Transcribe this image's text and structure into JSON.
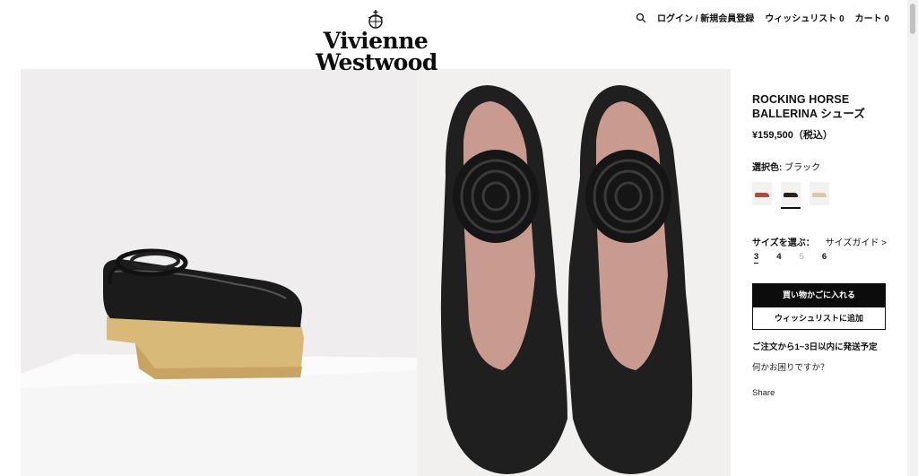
{
  "brand": {
    "line1": "Vivienne",
    "line2": "Westwood"
  },
  "nav": {
    "login": "ログイン / 新規会員登録",
    "wishlist": "ウィッシュリスト 0",
    "cart": "カート 0"
  },
  "product": {
    "title": "ROCKING HORSE BALLERINA シューズ",
    "price": "¥159,500（税込）",
    "color_label": "選択色:",
    "color_value": "ブラック",
    "swatches": [
      {
        "color": "#b8453a"
      },
      {
        "color": "#2a211c",
        "selected": true
      },
      {
        "color": "#d8c7a8"
      }
    ],
    "size_label": "サイズを選ぶ：",
    "size_guide": "サイズガイド >",
    "sizes": [
      "3",
      "4",
      "5",
      "6"
    ],
    "add_to_cart": "買い物かごに入れる",
    "add_to_wishlist": "ウィッシュリストに追加",
    "shipping_note": "ご注文から1~3日以内に発送予定",
    "help": "何かお困りですか？",
    "share": "Share"
  }
}
